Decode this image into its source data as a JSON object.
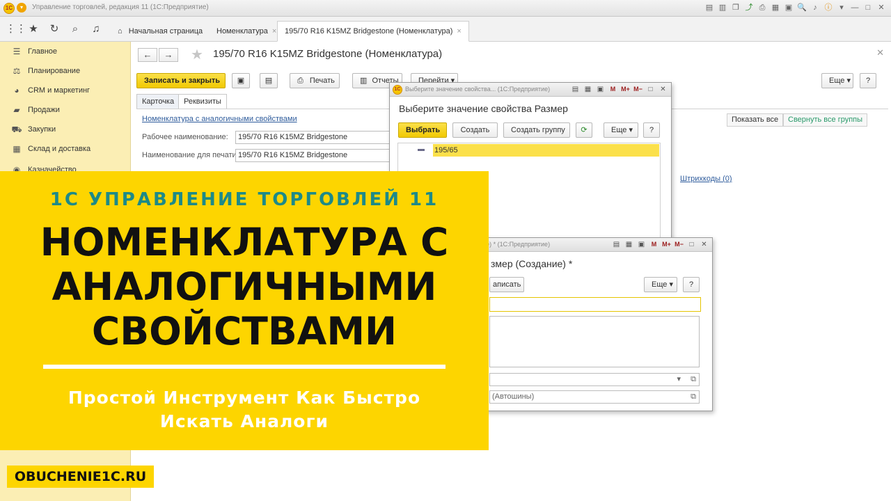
{
  "window": {
    "title": "Управление торговлей, редакция 11 (1С:Предприятие)",
    "logo": "1С"
  },
  "nav": {
    "tabs": [
      {
        "label": "Начальная страница"
      },
      {
        "label": "Номенклатура",
        "close": "×"
      },
      {
        "label": "195/70 R16 K15MZ Bridgestone (Номенклатура)",
        "close": "×"
      }
    ]
  },
  "sidebar": {
    "items": [
      {
        "label": "Главное",
        "icon": "menu-lines-icon"
      },
      {
        "label": "Планирование",
        "icon": "planning-icon"
      },
      {
        "label": "CRM и маркетинг",
        "icon": "pie-icon"
      },
      {
        "label": "Продажи",
        "icon": "bag-icon"
      },
      {
        "label": "Закупки",
        "icon": "cart-icon"
      },
      {
        "label": "Склад и доставка",
        "icon": "grid-icon"
      },
      {
        "label": "Казначейство",
        "icon": "money-icon"
      }
    ]
  },
  "form": {
    "title": "195/70 R16 K15MZ Bridgestone (Номенклатура)",
    "buttons": {
      "save_close": "Записать и закрыть",
      "print": "Печать",
      "reports": "Отчеты",
      "go": "Перейти",
      "more": "Еще",
      "help": "?"
    },
    "tabs": [
      "Карточка",
      "Реквизиты"
    ],
    "analog_link": "Номенклатура с аналогичными свойствами",
    "fields": [
      {
        "label": "Рабочее наименование:",
        "value": "195/70 R16 K15MZ Bridgestone"
      },
      {
        "label": "Наименование для печати:",
        "value": "195/70 R16 K15MZ Bridgestone"
      }
    ],
    "show_all": "Показать все",
    "collapse_groups": "Свернуть все группы",
    "barcodes_link": "Штрихкоды (0)"
  },
  "dialog1": {
    "bar_title": "Выберите значение свойства... (1С:Предприятие)",
    "title": "Выберите значение свойства Размер",
    "buttons": {
      "select": "Выбрать",
      "create": "Создать",
      "create_group": "Создать группу",
      "more": "Еще",
      "help": "?"
    },
    "rows": [
      "195/65"
    ]
  },
  "dialog2": {
    "bar_title": "оздание) * (1С:Предприятие)",
    "title": "змер (Создание) *",
    "buttons": {
      "save": "аписать",
      "more": "Еще",
      "help": "?"
    },
    "owner_value": "(Автошины)"
  },
  "banner": {
    "subtitle": "1С УПРАВЛЕНИЕ ТОРГОВЛЕЙ 11",
    "headline": [
      "НОМЕНКЛАТУРА С",
      "АНАЛОГИЧНЫМИ",
      "СВОЙСТВАМИ"
    ],
    "tagline": [
      "Простой Инструмент Как Быстро",
      "Искать Аналоги"
    ],
    "site": "OBUCHENIE1C.RU"
  }
}
